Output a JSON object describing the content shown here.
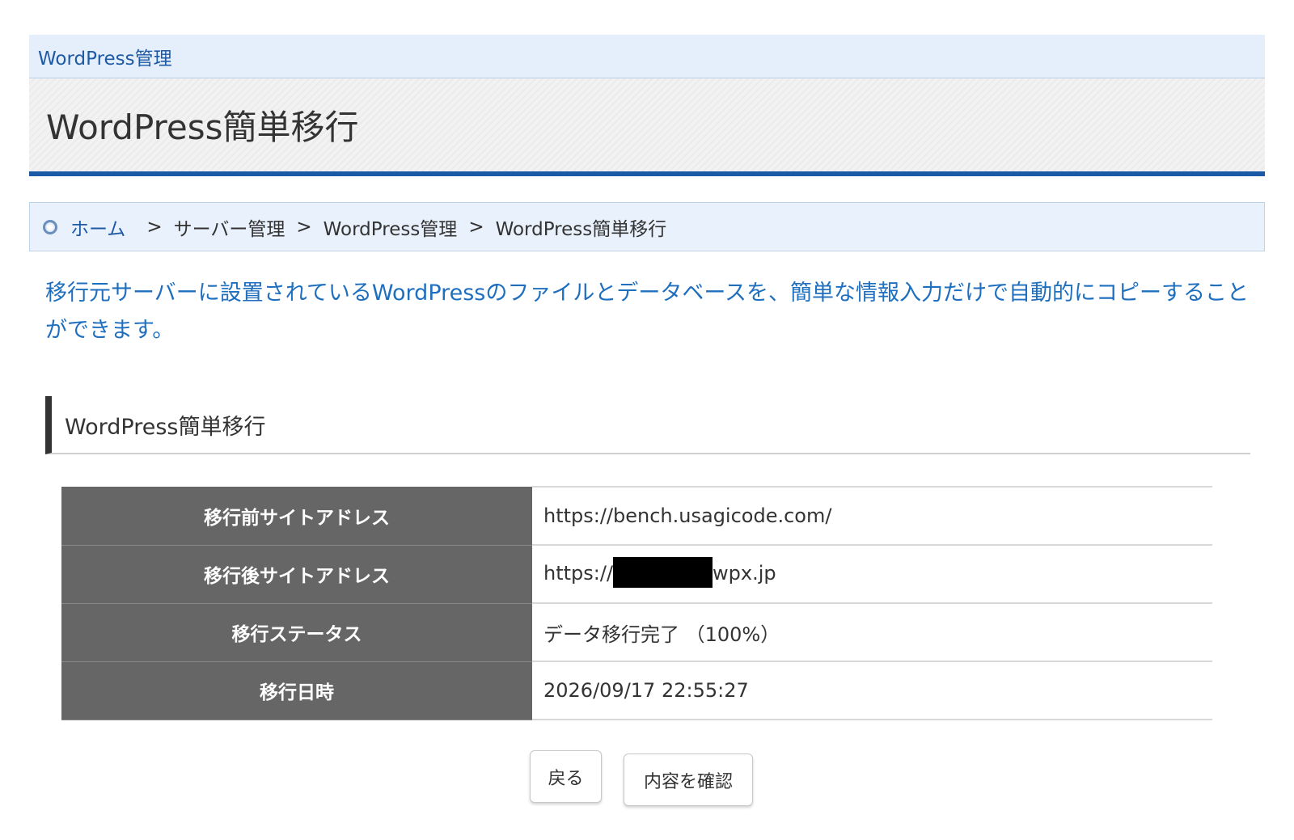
{
  "section_bar": {
    "label": "WordPress管理"
  },
  "title": "WordPress簡単移行",
  "breadcrumb": {
    "home": "ホーム",
    "separator": ">",
    "items": [
      "サーバー管理",
      "WordPress管理",
      "WordPress簡単移行"
    ]
  },
  "description": "移行元サーバーに設置されているWordPressのファイルとデータベースを、簡単な情報入力だけで自動的にコピーすることができます。",
  "subheading": "WordPress簡単移行",
  "table": {
    "rows": [
      {
        "label": "移行前サイトアドレス",
        "value": "https://bench.usagicode.com/"
      },
      {
        "label": "移行後サイトアドレス",
        "value_prefix": "https://",
        "value_suffix": "wpx.jp"
      },
      {
        "label": "移行ステータス",
        "value": "データ移行完了 （100%）"
      },
      {
        "label": "移行日時",
        "value": "2026/09/17 22:55:27"
      }
    ]
  },
  "buttons": {
    "back": "戻る",
    "confirm": "内容を確認"
  },
  "colors": {
    "accent_blue": "#1a59a6",
    "link_blue": "#1f5aa5",
    "description_blue": "#1f6fbf",
    "table_header_bg": "#666666"
  }
}
